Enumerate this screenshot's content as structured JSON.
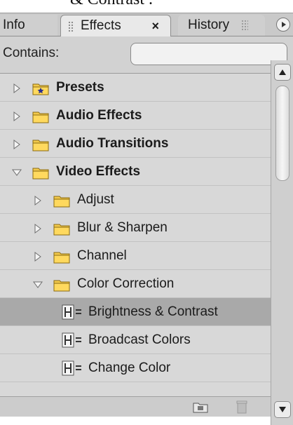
{
  "caption_fragment": "& Contrast .",
  "tabs": {
    "info": "Info",
    "effects": "Effects",
    "effects_close": "×",
    "history": "History"
  },
  "search": {
    "label": "Contains:",
    "value": "",
    "placeholder": ""
  },
  "tree": [
    {
      "label": "Presets",
      "level": 0,
      "expanded": false,
      "bold": true,
      "icon": "preset-folder-icon"
    },
    {
      "label": "Audio Effects",
      "level": 0,
      "expanded": false,
      "bold": true,
      "icon": "folder-icon"
    },
    {
      "label": "Audio Transitions",
      "level": 0,
      "expanded": false,
      "bold": true,
      "icon": "folder-icon"
    },
    {
      "label": "Video Effects",
      "level": 0,
      "expanded": true,
      "bold": true,
      "icon": "folder-icon"
    },
    {
      "label": "Adjust",
      "level": 1,
      "expanded": false,
      "bold": false,
      "icon": "folder-icon"
    },
    {
      "label": "Blur & Sharpen",
      "level": 1,
      "expanded": false,
      "bold": false,
      "icon": "folder-icon"
    },
    {
      "label": "Channel",
      "level": 1,
      "expanded": false,
      "bold": false,
      "icon": "folder-icon"
    },
    {
      "label": "Color Correction",
      "level": 1,
      "expanded": true,
      "bold": false,
      "icon": "folder-icon"
    },
    {
      "label": "Brightness & Contrast",
      "level": 2,
      "selected": true,
      "icon": "effect-icon"
    },
    {
      "label": "Broadcast Colors",
      "level": 2,
      "icon": "effect-icon"
    },
    {
      "label": "Change Color",
      "level": 2,
      "icon": "effect-icon"
    }
  ],
  "colors": {
    "folder": "#f2c94c",
    "selected_row": "#a9a9a9"
  }
}
